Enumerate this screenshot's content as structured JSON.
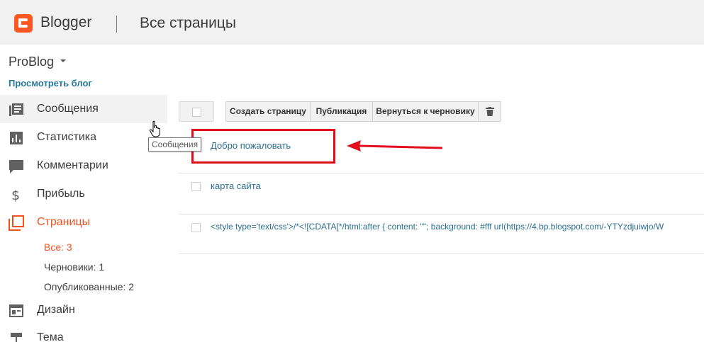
{
  "header": {
    "brand": "Blogger",
    "title": "Все страницы",
    "logo_color": "#ff5722"
  },
  "sidebar": {
    "blog_name": "ProBlog",
    "view_blog": "Просмотреть блог",
    "items": [
      {
        "label": "Сообщения",
        "icon": "posts-icon"
      },
      {
        "label": "Статистика",
        "icon": "stats-icon"
      },
      {
        "label": "Комментарии",
        "icon": "comments-icon"
      },
      {
        "label": "Прибыль",
        "icon": "dollar-icon"
      },
      {
        "label": "Страницы",
        "icon": "pages-icon"
      },
      {
        "label": "Дизайн",
        "icon": "layout-icon"
      },
      {
        "label": "Тема",
        "icon": "theme-icon"
      }
    ],
    "sub_items": [
      {
        "label": "Все: 3"
      },
      {
        "label": "Черновики: 1"
      },
      {
        "label": "Опубликованные: 2"
      }
    ],
    "active_color": "#f4511e"
  },
  "tooltip": "Сообщения",
  "toolbar": {
    "create": "Создать страницу",
    "publish": "Публикация",
    "revert": "Вернуться к черновику",
    "delete_icon": "trash-icon"
  },
  "pages": [
    {
      "title": "Добро пожаловать"
    },
    {
      "title": "карта сайта"
    },
    {
      "title": "<style type='text/css'>/*<![CDATA[*/html:after {  content: \"\";  background: #fff url(https://4.bp.blogspot.com/-YTYzdjuiwjo/W"
    }
  ],
  "annotation_color": "#e20e1d"
}
